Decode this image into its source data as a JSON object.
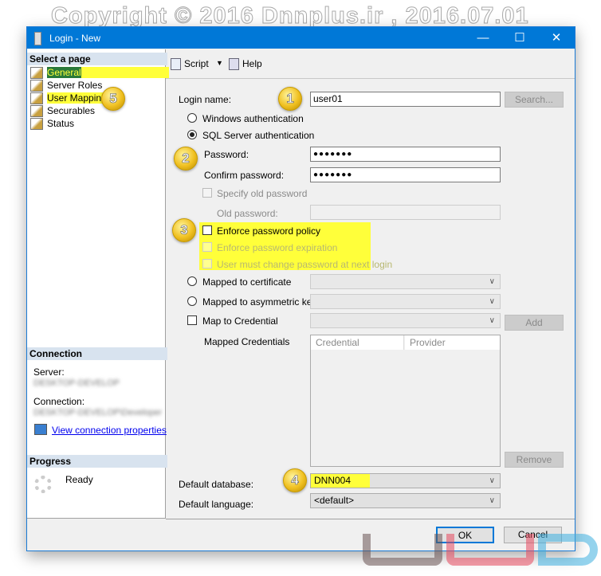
{
  "watermark": "Copyright © 2016 Dnnplus.ir , 2016.07.01",
  "window": {
    "title": "Login - New",
    "minimize": "—",
    "maximize": "☐",
    "close": "✕"
  },
  "left": {
    "select_header": "Select a page",
    "pages": [
      {
        "label": "General",
        "highlight": true
      },
      {
        "label": "Server Roles"
      },
      {
        "label": "User Mapping",
        "highlight": true
      },
      {
        "label": "Securables"
      },
      {
        "label": "Status"
      }
    ],
    "connection_header": "Connection",
    "server_label": "Server:",
    "server_value": "DESKTOP-DEVELOP",
    "connection_label": "Connection:",
    "connection_value": "DESKTOP-DEVELOP\\Developer",
    "view_link": "View connection properties",
    "progress_header": "Progress",
    "progress_status": "Ready"
  },
  "toolbar": {
    "script": "Script",
    "help": "Help"
  },
  "form": {
    "login_name_label": "Login name:",
    "login_name_value": "user01",
    "search_button": "Search...",
    "windows_auth": "Windows authentication",
    "sql_auth": "SQL Server authentication",
    "selected_auth": "sql",
    "password_label": "Password:",
    "password_value": "●●●●●●●",
    "confirm_label": "Confirm password:",
    "confirm_value": "●●●●●●●",
    "specify_old": "Specify old password",
    "old_password_label": "Old password:",
    "enforce_policy": "Enforce password policy",
    "enforce_expiration": "Enforce password expiration",
    "must_change": "User must change password at next login",
    "mapped_cert": "Mapped to certificate",
    "mapped_asym": "Mapped to asymmetric key",
    "map_credential": "Map to Credential",
    "add_button": "Add",
    "mapped_credentials_label": "Mapped Credentials",
    "cred_columns": [
      "Credential",
      "Provider"
    ],
    "remove_button": "Remove",
    "default_db_label": "Default database:",
    "default_db_value": "DNN004",
    "default_lang_label": "Default language:",
    "default_lang_value": "<default>"
  },
  "buttons": {
    "ok": "OK",
    "cancel": "Cancel"
  },
  "badges": [
    "1",
    "2",
    "3",
    "4",
    "5"
  ],
  "colors": {
    "titlebar": "#0078d7",
    "highlight": "#ffff3a",
    "link": "#0000ee"
  }
}
